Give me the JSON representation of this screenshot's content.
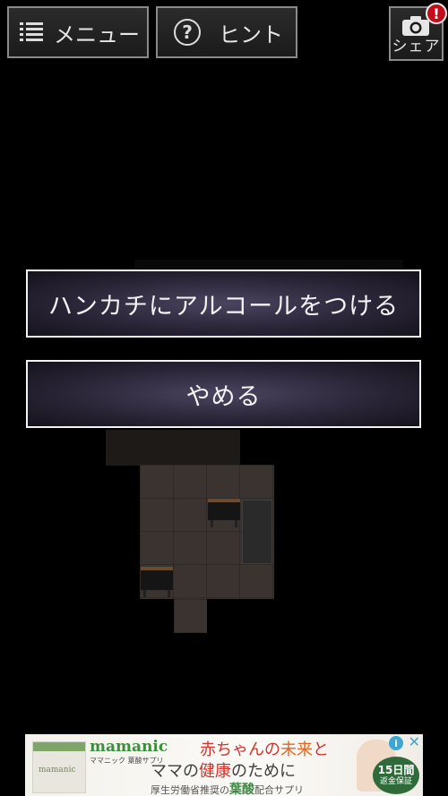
{
  "toolbar": {
    "menu_label": "メニュー",
    "hint_label": "ヒント",
    "share_label": "シェア",
    "alert_badge": "!"
  },
  "icons": {
    "menu": "list-icon",
    "hint": "question-circle-icon",
    "share": "camera-icon",
    "alert": "exclamation-badge-icon"
  },
  "choices": [
    {
      "label": "ハンカチにアルコールをつける"
    },
    {
      "label": "やめる"
    }
  ],
  "ad": {
    "brand": "mamanic",
    "brand_sub": "ママニック 葉酸サプリ",
    "line1_a": "赤ちゃんの",
    "line1_b": "未来",
    "line1_c": "と",
    "line2_a": "ママの",
    "line2_b": "健康",
    "line2_c": "のために",
    "line3_a": "厚生労働省推奨の",
    "line3_b": "葉酸",
    "line3_c": "配合サプリ",
    "seal_top": "15日間",
    "seal_bottom": "返金保証",
    "product_label": "mamanic",
    "info": "i",
    "close": "✕"
  },
  "colors": {
    "background": "#000000",
    "choice_border": "#f2f2f2",
    "choice_fill": "#2a2537",
    "alert": "#c40d1a",
    "ad_green": "#3d8d3f",
    "ad_red": "#d0342c"
  }
}
